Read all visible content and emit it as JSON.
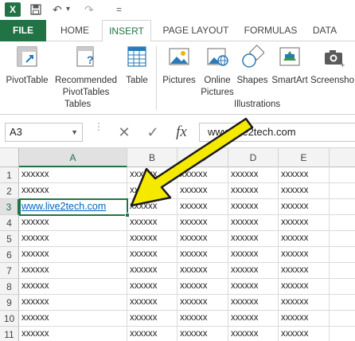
{
  "qat": {
    "app_icon": "excel-logo",
    "logo_letter": "X",
    "save_icon": "save-icon",
    "undo_glyph": "↶",
    "undo_dropdown_glyph": "▾",
    "redo_glyph": "↷",
    "customize_glyph": "="
  },
  "tabs": [
    "FILE",
    "HOME",
    "INSERT",
    "PAGE LAYOUT",
    "FORMULAS",
    "DATA"
  ],
  "active_tab": "INSERT",
  "ribbon": {
    "buttons": [
      {
        "id": "pivottable",
        "label1": "PivotTable",
        "label2": "",
        "icon": "pivottable-icon"
      },
      {
        "id": "recommended",
        "label1": "Recommended",
        "label2": "PivotTables",
        "icon": "recommended-pivottables-icon"
      },
      {
        "id": "table",
        "label1": "Table",
        "label2": "",
        "icon": "table-icon"
      },
      {
        "id": "pictures",
        "label1": "Pictures",
        "label2": "",
        "icon": "pictures-icon"
      },
      {
        "id": "online",
        "label1": "Online",
        "label2": "Pictures",
        "icon": "online-pictures-icon"
      },
      {
        "id": "shapes",
        "label1": "Shapes",
        "label2": "",
        "icon": "shapes-icon"
      },
      {
        "id": "smartart",
        "label1": "SmartArt",
        "label2": "",
        "icon": "smartart-icon"
      },
      {
        "id": "screenshot",
        "label1": "Screensho",
        "label2": "",
        "icon": "screenshot-icon"
      }
    ],
    "groups": [
      "Tables",
      "Illustrations"
    ]
  },
  "formula_bar": {
    "name_box": "A3",
    "name_box_dropdown": "▼",
    "cancel_glyph": "✕",
    "enter_glyph": "✓",
    "fx_label": "fx",
    "value": "www.live2tech.com"
  },
  "sheet": {
    "columns": [
      "A",
      "B",
      "C",
      "D",
      "E"
    ],
    "rows": [
      "1",
      "2",
      "3",
      "4",
      "5",
      "6",
      "7",
      "8",
      "9",
      "10",
      "11"
    ],
    "selected_cell": "A3",
    "filler": "xxxxxx",
    "a3_value": "www.live2tech.com"
  },
  "annotation": {
    "arrow_color": "#f5e900",
    "arrow_icon": "pointer-arrow"
  },
  "colors": {
    "accent": "#217346",
    "link": "#0563c1"
  }
}
